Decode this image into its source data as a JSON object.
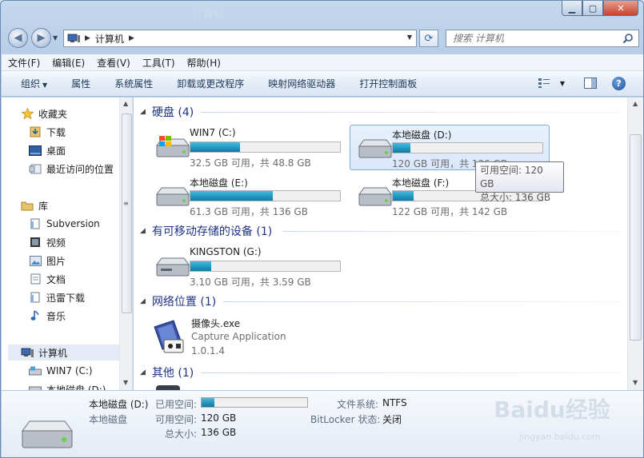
{
  "titlebar": {
    "title": "计算机",
    "min": "▁",
    "max": "▢",
    "close": "✕"
  },
  "address": {
    "path": [
      "计算机"
    ],
    "search_placeholder": "搜索 计算机"
  },
  "menu": [
    "文件(F)",
    "编辑(E)",
    "查看(V)",
    "工具(T)",
    "帮助(H)"
  ],
  "commands": [
    "组织",
    "属性",
    "系统属性",
    "卸载或更改程序",
    "映射网络驱动器",
    "打开控制面板"
  ],
  "nav": {
    "favorites": {
      "label": "收藏夹",
      "items": [
        "下载",
        "桌面",
        "最近访问的位置"
      ]
    },
    "libraries": {
      "label": "库",
      "items": [
        "Subversion",
        "视频",
        "图片",
        "文档",
        "迅雷下载",
        "音乐"
      ]
    },
    "computer": {
      "label": "计算机",
      "items": [
        "WIN7 (C:)",
        "本地磁盘 (D:)"
      ]
    }
  },
  "groups": {
    "hard_drives": "硬盘 (4)",
    "removable": "有可移动存储的设备 (1)",
    "network": "网络位置 (1)",
    "other": "其他 (1)"
  },
  "drives": [
    {
      "name": "WIN7 (C:)",
      "size": "32.5 GB 可用，共 48.8 GB",
      "used_fraction": 0.33
    },
    {
      "name": "本地磁盘 (D:)",
      "size": "120 GB 可用，共 136 GB",
      "used_fraction": 0.12
    },
    {
      "name": "本地磁盘 (E:)",
      "size": "61.3 GB 可用，共 136 GB",
      "used_fraction": 0.55
    },
    {
      "name": "本地磁盘 (F:)",
      "size": "122 GB 可用，共 142 GB",
      "used_fraction": 0.14
    },
    {
      "name": "KINGSTON (G:)",
      "size": "3.10 GB 可用，共 3.59 GB",
      "used_fraction": 0.14
    }
  ],
  "tooltip": {
    "line1": "可用空间: 120 GB",
    "line2": "总大小: 136 GB"
  },
  "network_item": {
    "name": "摄像头.exe",
    "desc": "Capture Application",
    "version": "1.0.1.4"
  },
  "details": {
    "name": "本地磁盘 (D:)",
    "type": "本地磁盘",
    "used_label": "已用空间:",
    "used_fraction": 0.12,
    "free_label": "可用空间:",
    "free_value": "120 GB",
    "total_label": "总大小:",
    "total_value": "136 GB",
    "fs_label": "文件系统:",
    "fs_value": "NTFS",
    "bitlocker_label": "BitLocker 状态:",
    "bitlocker_value": "关闭"
  },
  "watermark": {
    "brand": "Baidu经验",
    "url": "jingyan.baidu.com"
  },
  "colors": {
    "accent": "#1e3287",
    "bar": "#26a0c8",
    "selection": "#d8e7fa"
  }
}
